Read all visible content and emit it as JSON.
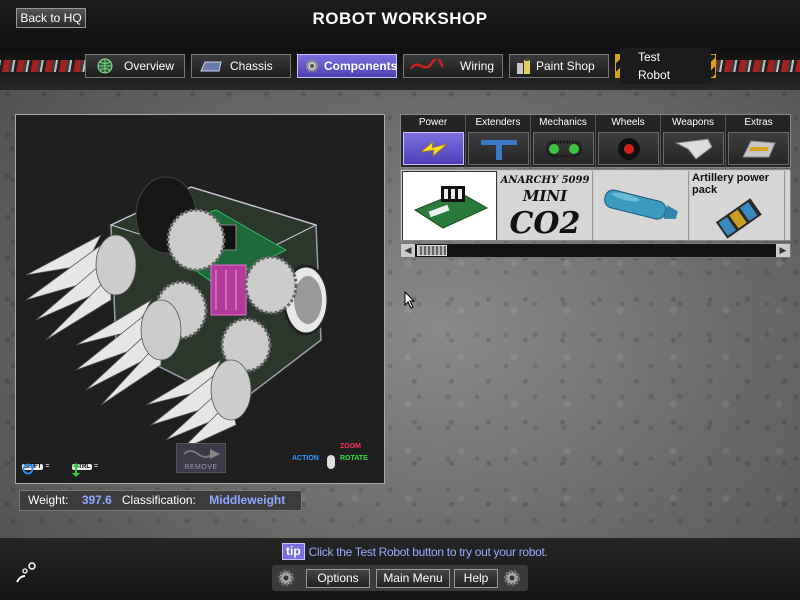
{
  "header": {
    "back_label": "Back to HQ",
    "title": "ROBOT WORKSHOP"
  },
  "tabs": [
    {
      "label": "Overview",
      "icon": "globe-icon",
      "active": false
    },
    {
      "label": "Chassis",
      "icon": "chassis-icon",
      "active": false
    },
    {
      "label": "Components",
      "icon": "gear-icon",
      "active": true
    },
    {
      "label": "Wiring",
      "icon": "wire-icon",
      "active": false
    },
    {
      "label": "Paint Shop",
      "icon": "paint-icon",
      "active": false
    },
    {
      "label": "Test Robot",
      "icon": "hazard-stripe",
      "active": false
    }
  ],
  "viewport": {
    "shift_key": "SHIFT",
    "ctrl_key": "CTRL",
    "remove_label": "REMOVE",
    "mouse": {
      "action": "ACTION",
      "zoom": "ZOOM",
      "rotate": "ROTATE"
    }
  },
  "info": {
    "weight_label": "Weight:",
    "weight_value": "397.6",
    "class_label": "Classification:",
    "class_value": "Middleweight"
  },
  "categories": [
    {
      "label": "Power",
      "icon": "lightning-icon",
      "active": true
    },
    {
      "label": "Extenders",
      "icon": "extender-icon",
      "active": false
    },
    {
      "label": "Mechanics",
      "icon": "chain-icon",
      "active": false
    },
    {
      "label": "Wheels",
      "icon": "wheel-icon",
      "active": false
    },
    {
      "label": "Weapons",
      "icon": "blade-icon",
      "active": false
    },
    {
      "label": "Extras",
      "icon": "shovel-icon",
      "active": false
    }
  ],
  "items": [
    {
      "label": "",
      "icon": "circuit-board-icon",
      "selected": true
    },
    {
      "label": "",
      "icon": "co2-canister-logo",
      "logo_text": [
        "ANARCHY 5099",
        "MINI",
        "CO2"
      ],
      "selected": false
    },
    {
      "label": "",
      "icon": "blue-tank-icon",
      "selected": false
    },
    {
      "label": "Artillery power pack",
      "icon": "battery-pack-icon",
      "selected": false
    }
  ],
  "tip": {
    "badge": "tip",
    "text": "Click the Test Robot button to try out your robot."
  },
  "bottom_buttons": {
    "options": "Options",
    "main_menu": "Main Menu",
    "help": "Help"
  },
  "colors": {
    "accent": "#6f62d8",
    "info_value": "#8ea8ff",
    "hazard": "#d9a21b"
  }
}
